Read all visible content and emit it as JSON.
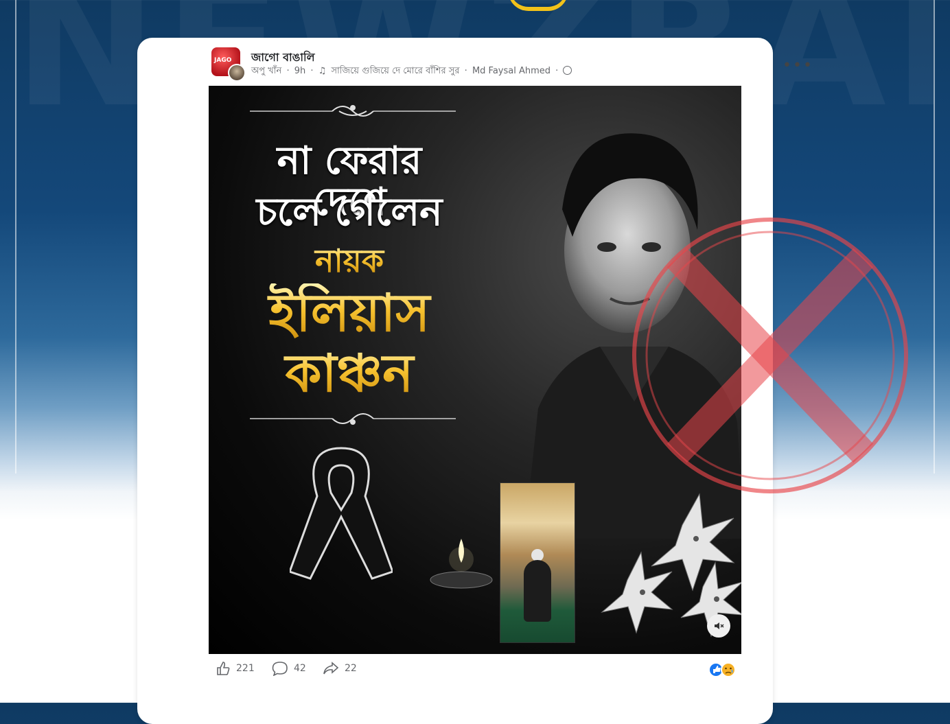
{
  "background": {
    "watermark_text": "NEWZBANGLA",
    "colors": {
      "top": "#0f3a62",
      "accent_gold": "#f2c21a"
    }
  },
  "post": {
    "page_name": "জাগো বাঙালি",
    "author": "অপু খাঁন",
    "time": "9h",
    "song": "সাজিয়ে গুজিয়ে দে মোরে বাঁশির সুর",
    "credit": "Md Faysal Ahmed",
    "avatar_badge": "JAGO",
    "more_icon": "more-horizontal-icon"
  },
  "image": {
    "line1": "না ফেরার দেশে",
    "line2": "চলে গেলেন",
    "line3": "নায়ক",
    "line4": "ইলিয়াস",
    "line5": "কাঞ্চন"
  },
  "stats": {
    "likes": "221",
    "comments": "42",
    "shares": "22"
  },
  "stamp": {
    "meaning": "fake",
    "color": "#e8454a"
  }
}
